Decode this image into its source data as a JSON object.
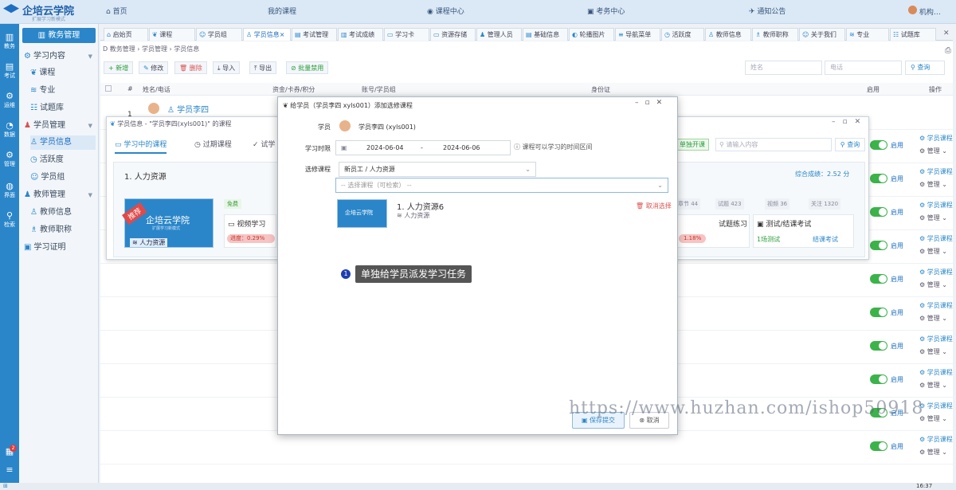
{
  "topbar": {
    "logo_main": "企培云学院",
    "logo_sub": "扩展学习新模式",
    "nav": [
      "首页",
      "我的课程",
      "课程中心",
      "考务中心",
      "通知公告"
    ],
    "user": "机构…"
  },
  "rail": {
    "items": [
      "教务",
      "考试",
      "运维",
      "数据",
      "管理",
      "界面",
      "检索"
    ],
    "badge": "2"
  },
  "side": {
    "header": "教务管理",
    "items": [
      "学习内容",
      "课程",
      "专业",
      "试题库",
      "学员管理",
      "学员信息",
      "活跃度",
      "学员组",
      "教师管理",
      "教师信息",
      "教师职称",
      "学习证明"
    ]
  },
  "tabs": [
    "启始页",
    "课程",
    "学员组",
    "学员信息",
    "考试管理",
    "考试成绩",
    "学习卡",
    "资源存储",
    "管理人员",
    "基础信息",
    "轮播图片",
    "导航菜单",
    "活跃度",
    "教师信息",
    "教师职称",
    "关于我们",
    "专业",
    "试题库"
  ],
  "content": {
    "breadcrumb": "D 教务管理 › 学员管理 › 学员信息",
    "toolbar": [
      "+ 新增",
      "修改",
      "删除",
      "导入",
      "导出",
      "批量禁用"
    ],
    "search_name": "姓名",
    "search_phone": "电话",
    "search_btn": "查询",
    "headers": [
      "#",
      "姓名/电话",
      "资金/卡券/积分",
      "账号/学员组",
      "身份证",
      "启用",
      "操作"
    ],
    "first_row": {
      "index": "1",
      "name": "学员李四"
    },
    "toggle_label": "启用",
    "op1": "学员课程",
    "op2": "管理"
  },
  "win2": {
    "title": "学员信息 - \"学员李四(xyls001)\" 的课程",
    "tabs": [
      "学习中的课程",
      "过期课程",
      "试学"
    ],
    "btn_open": "单独开课",
    "search_ph": "请输入内容",
    "search_btn": "查询",
    "course_title": "1. 人力资源",
    "score": "综合成绩：2.52 分",
    "tag_free": "免费",
    "tag_rec": "推荐",
    "thumb_name": "企培云学院",
    "thumb_sub": "扩展学习新模式",
    "course_name": "人力资源",
    "stats": [
      "章节 44",
      "试题 423",
      "视频 36",
      "关注 1320"
    ],
    "video": "视频学习",
    "progress": "进度：0.29%",
    "practice": "试题练习",
    "practice_progress": "1.18%",
    "exam": "测试/结课考试",
    "exam_count": "1场测试",
    "exam_link": "结课考试"
  },
  "modal": {
    "title": "给学员（学员李四 xyls001）添加选修课程",
    "student_label": "学员",
    "student_value": "学员李四 (xyls001)",
    "time_label": "学习时限",
    "date_start": "2024-06-04",
    "date_sep": "-",
    "date_end": "2024-06-06",
    "time_hint": "课程可以学习的时间区间",
    "course_label": "选修课程",
    "course_value": "新员工 / 人力资源",
    "select_ph": "-- 选择课程（可检索） --",
    "item_title": "1. 人力资源6",
    "item_sub": "人力资源",
    "item_thumb": "企培云学院",
    "cancel_select": "取消选择",
    "save": "保存提交",
    "cancel": "取消"
  },
  "tooltip": {
    "num": "1",
    "text": "单独给学员派发学习任务"
  },
  "watermark": "https://www.huzhan.com/ishop50918",
  "clock": "16:37"
}
